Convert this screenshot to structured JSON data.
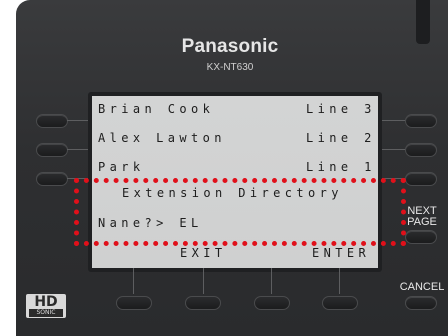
{
  "device": {
    "brand": "Panasonic",
    "model": "KX-NT630",
    "hd_logo_text": "HD",
    "hd_logo_subtext": "SONIC"
  },
  "lcd": {
    "rows": [
      {
        "left": "Brian Cook",
        "right": "Line 3"
      },
      {
        "left": "Alex Lawton",
        "right": "Line 2"
      },
      {
        "left": "Park",
        "right": "Line 1"
      }
    ],
    "directory_title": "Extension Directory",
    "name_prompt": "Nane?> EL",
    "softkeys": {
      "exit": "EXIT",
      "enter": "ENTER"
    }
  },
  "side_labels": {
    "next_page_line1": "NEXT",
    "next_page_line2": "PAGE",
    "cancel": "CANCEL"
  },
  "colors": {
    "body": "#2e2f31",
    "lcd_background": "#d0d1d1",
    "highlight": "#e0101a"
  }
}
